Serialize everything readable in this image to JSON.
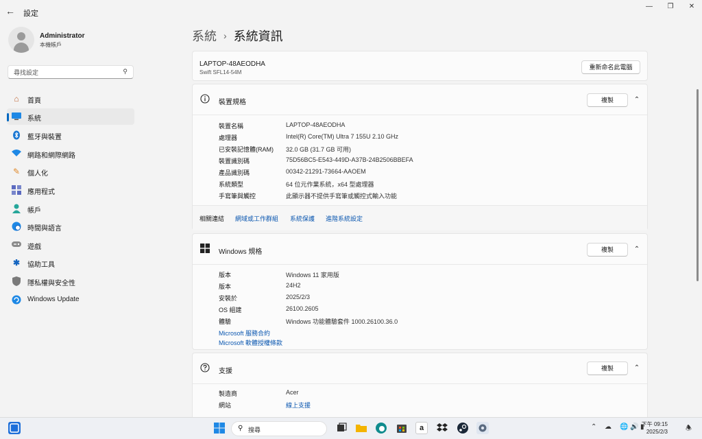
{
  "window": {
    "title": "設定",
    "back_icon": "back-arrow-icon",
    "controls": [
      "minimize-icon",
      "maximize-icon",
      "close-icon"
    ]
  },
  "user": {
    "name": "Administrator",
    "account_type": "本機帳戶"
  },
  "search": {
    "placeholder": "尋找設定"
  },
  "sidebar": {
    "items": [
      {
        "label": "首頁",
        "icon": "home-icon"
      },
      {
        "label": "系統",
        "icon": "system-icon",
        "selected": true
      },
      {
        "label": "藍牙與裝置",
        "icon": "bluetooth-icon"
      },
      {
        "label": "網路和網際網路",
        "icon": "wifi-icon"
      },
      {
        "label": "個人化",
        "icon": "brush-icon"
      },
      {
        "label": "應用程式",
        "icon": "apps-icon"
      },
      {
        "label": "帳戶",
        "icon": "person-icon"
      },
      {
        "label": "時間與語言",
        "icon": "globe-clock-icon"
      },
      {
        "label": "遊戲",
        "icon": "gamepad-icon"
      },
      {
        "label": "協助工具",
        "icon": "accessibility-icon"
      },
      {
        "label": "隱私權與安全性",
        "icon": "shield-icon"
      },
      {
        "label": "Windows Update",
        "icon": "update-icon"
      }
    ]
  },
  "breadcrumb": {
    "parent": "系統",
    "separator": "›",
    "current": "系統資訊"
  },
  "pc": {
    "name": "LAPTOP-48AEODHA",
    "model": "Swift SFL14-54M",
    "rename_button": "重新命名此電腦"
  },
  "device_specs": {
    "title": "裝置規格",
    "copy_button": "複製",
    "rows": [
      {
        "label": "裝置名稱",
        "value": "LAPTOP-48AEODHA"
      },
      {
        "label": "處理器",
        "value": "Intel(R) Core(TM) Ultra 7 155U   2.10 GHz"
      },
      {
        "label": "已安裝記憶體(RAM)",
        "value": "32.0 GB (31.7 GB 可用)"
      },
      {
        "label": "裝置識別碼",
        "value": "75D56BC5-E543-449D-A37B-24B2506BBEFA"
      },
      {
        "label": "產品識別碼",
        "value": "00342-21291-73664-AAOEM"
      },
      {
        "label": "系統類型",
        "value": "64 位元作業系統，x64 型處理器"
      },
      {
        "label": "手寫筆與觸控",
        "value": "此顯示器不提供手寫筆或觸控式輸入功能"
      }
    ]
  },
  "related_links": {
    "label": "相關連結",
    "links": [
      "網域或工作群組",
      "系統保護",
      "進階系統設定"
    ]
  },
  "windows_specs": {
    "title": "Windows 規格",
    "copy_button": "複製",
    "rows": [
      {
        "label": "版本",
        "value": "Windows 11 家用版"
      },
      {
        "label": "版本",
        "value": "24H2"
      },
      {
        "label": "安裝於",
        "value": "2025/2/3"
      },
      {
        "label": "OS 組建",
        "value": "26100.2605"
      },
      {
        "label": "體驗",
        "value": "Windows 功能體驗套件 1000.26100.36.0"
      }
    ],
    "links": [
      "Microsoft 服務合約",
      "Microsoft 軟體授權條款"
    ]
  },
  "support": {
    "title": "支援",
    "copy_button": "複製",
    "rows": [
      {
        "label": "製造商",
        "value": "Acer"
      },
      {
        "label": "網站",
        "value": "線上支援",
        "is_link": true
      }
    ]
  },
  "taskbar": {
    "search_label": "搜尋",
    "time": "下午 09:15",
    "date": "2025/2/3"
  },
  "colors": {
    "accent": "#0067c0",
    "link": "#0b57b0",
    "background": "#f3f3f3",
    "card": "#fbfbfb"
  }
}
